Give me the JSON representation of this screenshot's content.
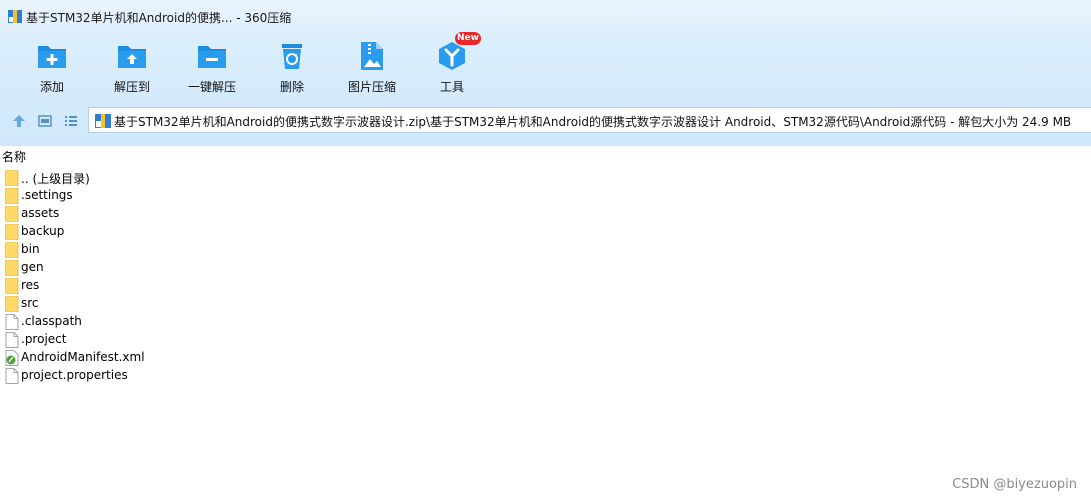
{
  "window": {
    "title": "基于STM32单片机和Android的便携... - 360压缩"
  },
  "toolbar": {
    "items": [
      {
        "label": "添加",
        "icon": "add-icon"
      },
      {
        "label": "解压到",
        "icon": "extract-to-icon"
      },
      {
        "label": "一键解压",
        "icon": "one-click-extract-icon"
      },
      {
        "label": "删除",
        "icon": "delete-icon"
      },
      {
        "label": "图片压缩",
        "icon": "image-compress-icon"
      },
      {
        "label": "工具",
        "icon": "tools-icon"
      }
    ],
    "new_badge": "New"
  },
  "nav": {
    "path": "基于STM32单片机和Android的便携式数字示波器设计.zip\\基于STM32单片机和Android的便携式数字示波器设计 Android、STM32源代码\\Android源代码 - 解包大小为 24.9 MB"
  },
  "list": {
    "column_name": "名称",
    "items": [
      {
        "name": ".. (上级目录)",
        "type": "folder"
      },
      {
        "name": ".settings",
        "type": "folder"
      },
      {
        "name": "assets",
        "type": "folder"
      },
      {
        "name": "backup",
        "type": "folder"
      },
      {
        "name": "bin",
        "type": "folder"
      },
      {
        "name": "gen",
        "type": "folder"
      },
      {
        "name": "res",
        "type": "folder"
      },
      {
        "name": "src",
        "type": "folder"
      },
      {
        "name": ".classpath",
        "type": "file"
      },
      {
        "name": ".project",
        "type": "file"
      },
      {
        "name": "AndroidManifest.xml",
        "type": "xml"
      },
      {
        "name": "project.properties",
        "type": "file"
      }
    ]
  },
  "watermark": "CSDN @biyezuopin",
  "colors": {
    "toolbar_bg": "#dbeefc",
    "icon_blue": "#1d8de0",
    "folder_yellow": "#ffd867",
    "badge_red": "#e8272a"
  }
}
